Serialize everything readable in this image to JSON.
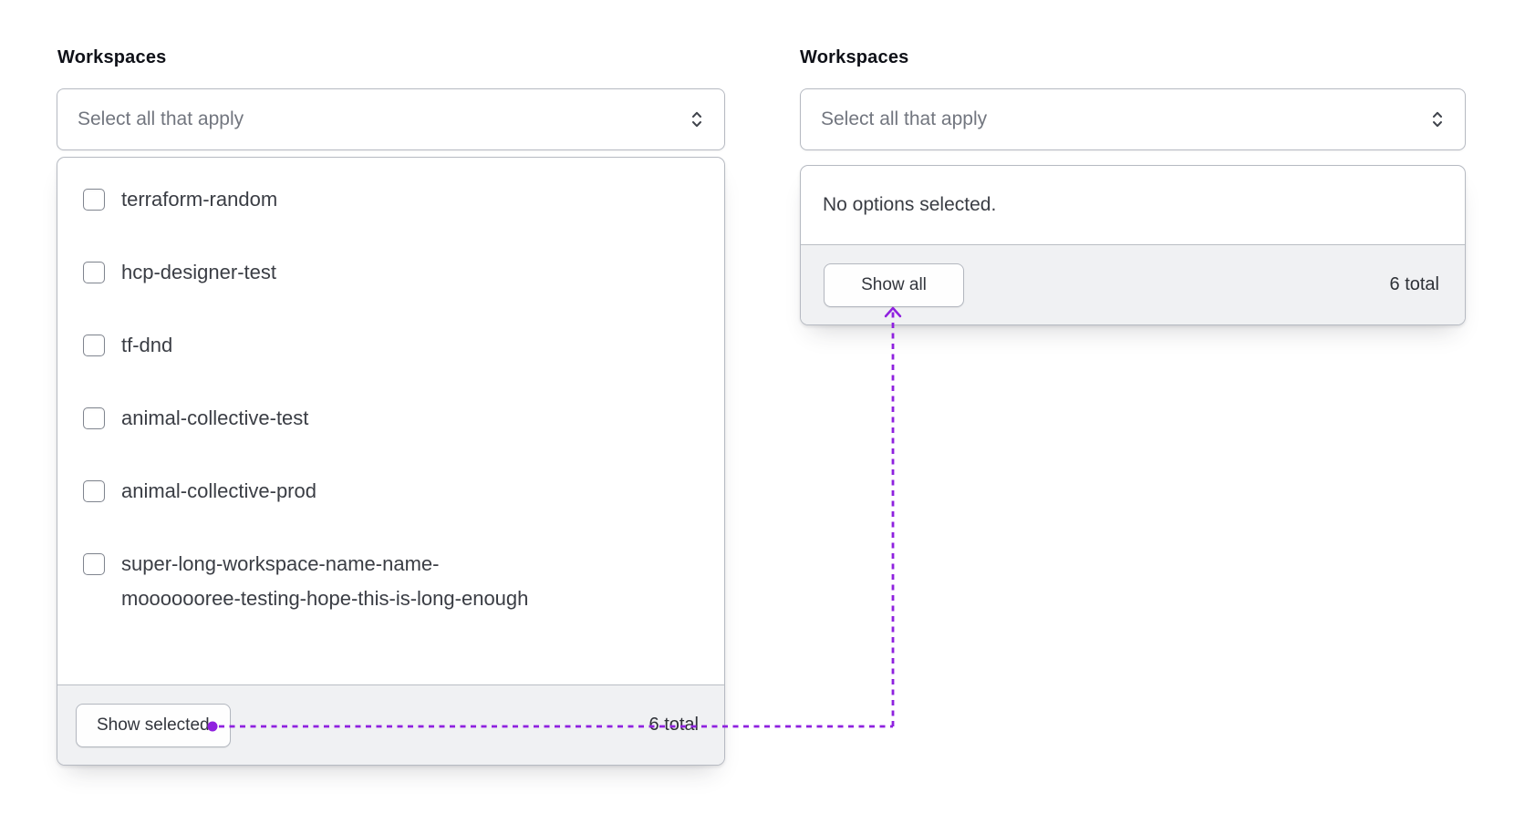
{
  "annotation": {
    "color": "#8F21DF"
  },
  "left_combobox": {
    "label": "Workspaces",
    "select": {
      "placeholder": "Select all that apply",
      "toggle_icon": "chevron-up-down-icon"
    },
    "options": [
      {
        "label": "terraform-random",
        "checked": false
      },
      {
        "label": "hcp-designer-test",
        "checked": false
      },
      {
        "label": "tf-dnd",
        "checked": false
      },
      {
        "label": "animal-collective-test",
        "checked": false
      },
      {
        "label": "animal-collective-prod",
        "checked": false
      },
      {
        "label": "super-long-workspace-name-name-\nmooooooree-testing-hope-this-is-long-enough",
        "checked": false
      }
    ],
    "footer": {
      "button_label": "Show selected",
      "total": "6 total"
    }
  },
  "right_combobox": {
    "label": "Workspaces",
    "select": {
      "placeholder": "Select all that apply",
      "toggle_icon": "chevron-up-down-icon"
    },
    "empty_message": "No options selected.",
    "footer": {
      "button_label": "Show all",
      "total": "6 total"
    }
  }
}
